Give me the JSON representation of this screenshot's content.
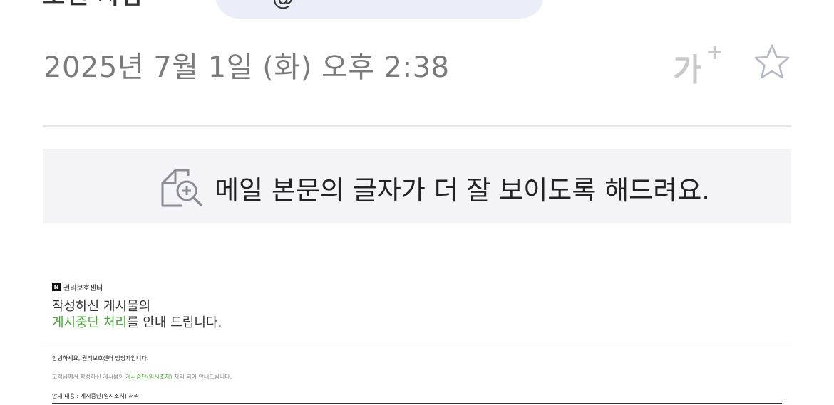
{
  "header": {
    "top_left_text": "보낸 사람",
    "top_pill_text": "@"
  },
  "mail_meta": {
    "date": "2025년 7월 1일 (화) 오후 2:38",
    "font_size_label": "가",
    "font_size_plus": "+"
  },
  "banner": {
    "text": "메일 본문의 글자가 더 잘 보이도록 해드려요."
  },
  "mail_body": {
    "brand_logo": "N",
    "brand_name": "권리보호센터",
    "headline_line1": "작성하신 게시물의",
    "headline_green": "게시중단 처리",
    "headline_rest": "를 안내 드립니다.",
    "greeting": "안녕하세요, 권리보호센터 담당자입니다.",
    "info_prefix": "고객님께서 작성하신 게시물이 ",
    "info_green": "게시중단(임시조치)",
    "info_suffix": " 처리 되어 안내드립니다.",
    "guide_text": "안내 내용 : 게시중단(임시조치) 처리"
  },
  "colors": {
    "accent_green": "#4aa63b",
    "banner_bg": "#f4f4f6",
    "pill_bg": "#e9eef9"
  },
  "icons": {
    "star": "star-icon",
    "zoom": "document-zoom-icon"
  }
}
